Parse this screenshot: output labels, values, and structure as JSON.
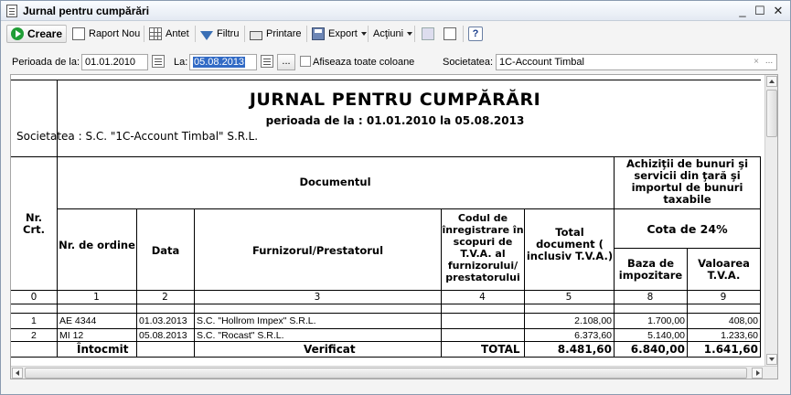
{
  "window": {
    "title": "Jurnal pentru cumpărări",
    "minimize": "_",
    "maximize": "☐",
    "close": "✕"
  },
  "toolbar": {
    "create": "Creare",
    "report": "Raport Nou",
    "header": "Antet",
    "filter": "Filtru",
    "print": "Printare",
    "export": "Export",
    "actions": "Acţiuni",
    "help": "?"
  },
  "filters": {
    "period_from_label": "Perioada de la:",
    "period_from": "01.01.2010",
    "to_label": "La:",
    "period_to": "05.08.2013",
    "dots": "...",
    "show_all_columns_label": "Afiseaza toate coloane",
    "show_all_columns_checked": false,
    "company_label": "Societatea:",
    "company": "1C-Account Timbal"
  },
  "report": {
    "title": "JURNAL PENTRU CUMPĂRĂRI",
    "period": "perioada de la : 01.01.2010 la 05.08.2013",
    "company_line": "Societatea :  S.C. \"1C-Account Timbal\" S.R.L.",
    "headers": {
      "nr": "Nr.\nCrt.",
      "document": "Documentul",
      "acquisitions": "Achiziţii de bunuri şi servicii din ţară şi importul de bunuri taxabile",
      "order_nr": "Nr. de ordine",
      "date": "Data",
      "supplier": "Furnizorul/Prestatorul",
      "vat_code": "Codul de înregistrare în scopuri de T.V.A. al furnizorului/ prestatorului",
      "total_doc": "Total document ( inclusiv T.V.A.)",
      "rate": "Cota de 24%",
      "tax_base": "Baza de impozitare",
      "vat_value": "Valoarea T.V.A."
    },
    "col_numbers": [
      "0",
      "1",
      "2",
      "3",
      "4",
      "5",
      "8",
      "9"
    ],
    "rows": [
      {
        "nr": "1",
        "order": "AE 4344",
        "date": "01.03.2013",
        "supplier": "S.C. \"Hollrom Impex\" S.R.L.",
        "code": "",
        "total": "2.108,00",
        "base": "1.700,00",
        "vat": "408,00"
      },
      {
        "nr": "2",
        "order": "MI 12",
        "date": "05.08.2013",
        "supplier": "S.C. \"Rocast\" S.R.L.",
        "code": "",
        "total": "6.373,60",
        "base": "5.140,00",
        "vat": "1.233,60"
      }
    ],
    "footer": {
      "drawn_up": "Întocmit",
      "checked": "Verificat",
      "total_label": "TOTAL",
      "total": "8.481,60",
      "base": "6.840,00",
      "vat": "1.641,60"
    }
  }
}
